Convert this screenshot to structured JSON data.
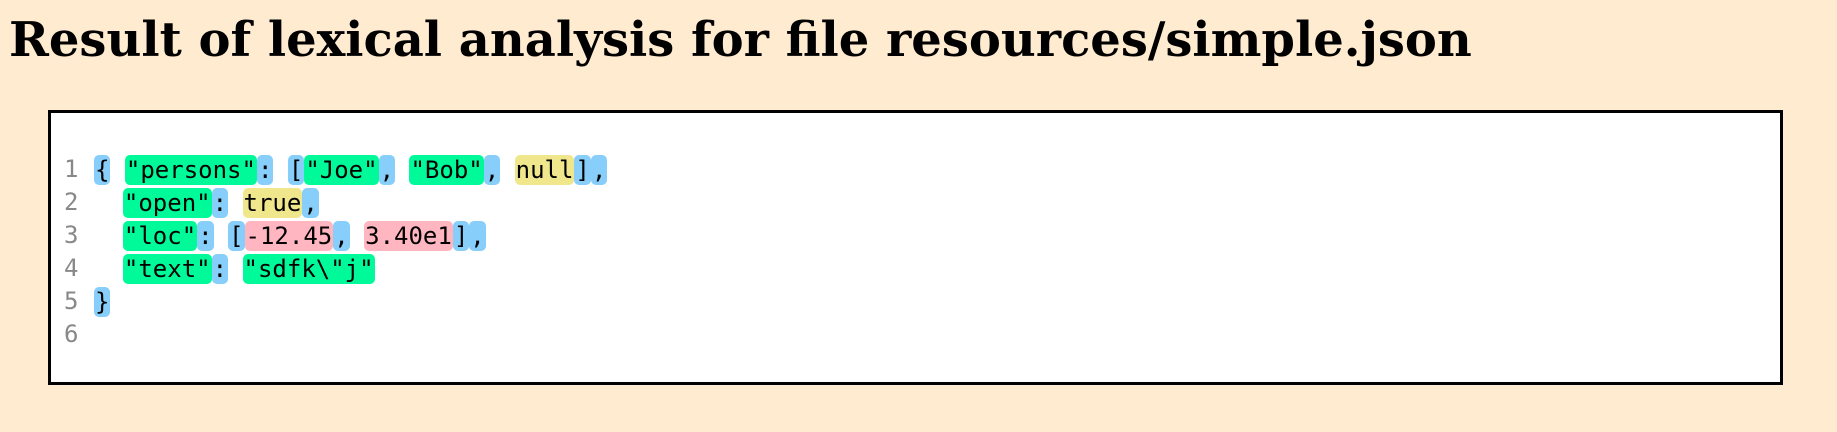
{
  "page": {
    "title": "Result of lexical analysis for file resources/simple.json"
  },
  "colors": {
    "punct": "#87cefa",
    "string": "#00fa9a",
    "literal": "#f0e68c",
    "number": "#ffb6c1"
  },
  "lines": [
    {
      "number": "1",
      "tokens": [
        {
          "t": "punct",
          "v": "{"
        },
        {
          "t": "ws",
          "v": " "
        },
        {
          "t": "string",
          "v": "\"persons\""
        },
        {
          "t": "punct",
          "v": ":"
        },
        {
          "t": "ws",
          "v": " "
        },
        {
          "t": "punct",
          "v": "["
        },
        {
          "t": "string",
          "v": "\"Joe\""
        },
        {
          "t": "punct",
          "v": ","
        },
        {
          "t": "ws",
          "v": " "
        },
        {
          "t": "string",
          "v": "\"Bob\""
        },
        {
          "t": "punct",
          "v": ","
        },
        {
          "t": "ws",
          "v": " "
        },
        {
          "t": "literal",
          "v": "null"
        },
        {
          "t": "punct",
          "v": "]"
        },
        {
          "t": "punct",
          "v": ","
        }
      ]
    },
    {
      "number": "2",
      "tokens": [
        {
          "t": "ws",
          "v": "  "
        },
        {
          "t": "string",
          "v": "\"open\""
        },
        {
          "t": "punct",
          "v": ":"
        },
        {
          "t": "ws",
          "v": " "
        },
        {
          "t": "literal",
          "v": "true"
        },
        {
          "t": "punct",
          "v": ","
        }
      ]
    },
    {
      "number": "3",
      "tokens": [
        {
          "t": "ws",
          "v": "  "
        },
        {
          "t": "string",
          "v": "\"loc\""
        },
        {
          "t": "punct",
          "v": ":"
        },
        {
          "t": "ws",
          "v": " "
        },
        {
          "t": "punct",
          "v": "["
        },
        {
          "t": "number",
          "v": "-12.45"
        },
        {
          "t": "punct",
          "v": ","
        },
        {
          "t": "ws",
          "v": " "
        },
        {
          "t": "number",
          "v": "3.40e1"
        },
        {
          "t": "punct",
          "v": "]"
        },
        {
          "t": "punct",
          "v": ","
        }
      ]
    },
    {
      "number": "4",
      "tokens": [
        {
          "t": "ws",
          "v": "  "
        },
        {
          "t": "string",
          "v": "\"text\""
        },
        {
          "t": "punct",
          "v": ":"
        },
        {
          "t": "ws",
          "v": " "
        },
        {
          "t": "string",
          "v": "\"sdfk\\\"j\""
        }
      ]
    },
    {
      "number": "5",
      "tokens": [
        {
          "t": "punct",
          "v": "}"
        }
      ]
    },
    {
      "number": "6",
      "tokens": []
    }
  ]
}
